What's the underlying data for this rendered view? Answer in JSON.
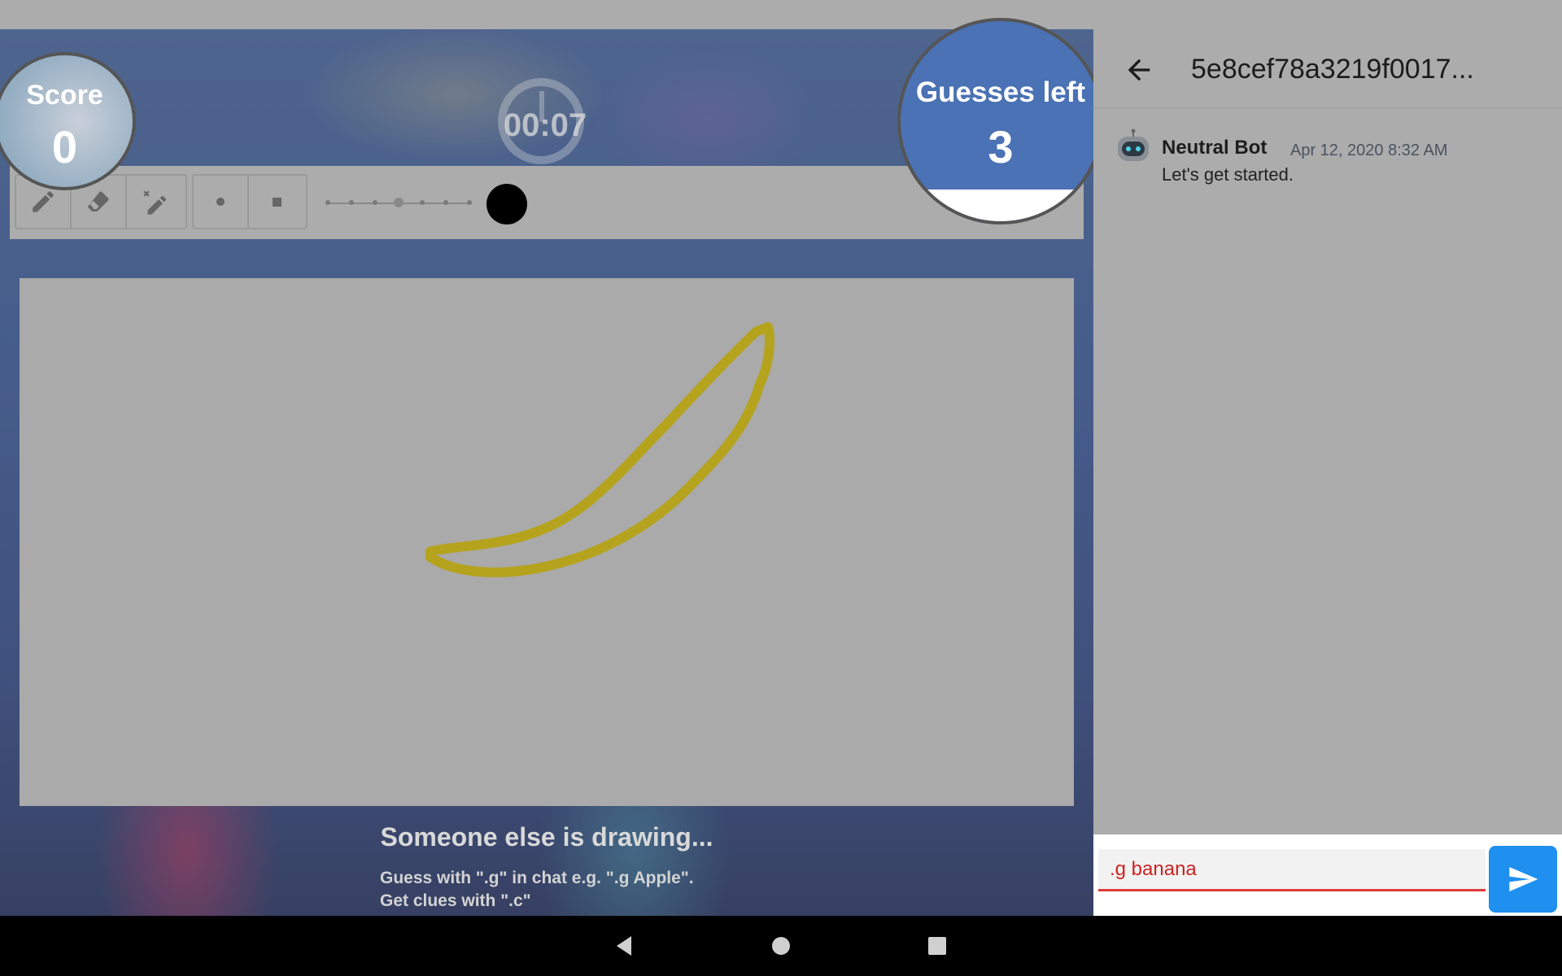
{
  "game": {
    "timer": "00:07",
    "score_label": "Score",
    "score_value": "0",
    "guesses_label": "Guesses left",
    "guesses_value": "3",
    "status_title": "Someone else is drawing...",
    "hint_guess": "Guess with \".g\" in chat e.g. \".g Apple\".",
    "hint_clue": "Get clues with \".c\"",
    "drawing_color": "#b5a31e",
    "brush_color": "#000000",
    "tools": [
      "pencil-icon",
      "eraser-icon",
      "magic-pencil-icon"
    ],
    "brush_shapes": [
      "round-brush-icon",
      "square-brush-icon"
    ],
    "brush_size_level": 4,
    "brush_size_steps": 7
  },
  "chat": {
    "title": "5e8cef78a3219f0017...",
    "messages": [
      {
        "author": "Neutral Bot",
        "time": "Apr 12, 2020 8:32 AM",
        "text": "Let's get started."
      }
    ],
    "input_value": ".g banana",
    "accent_color": "#1f8ff0"
  }
}
